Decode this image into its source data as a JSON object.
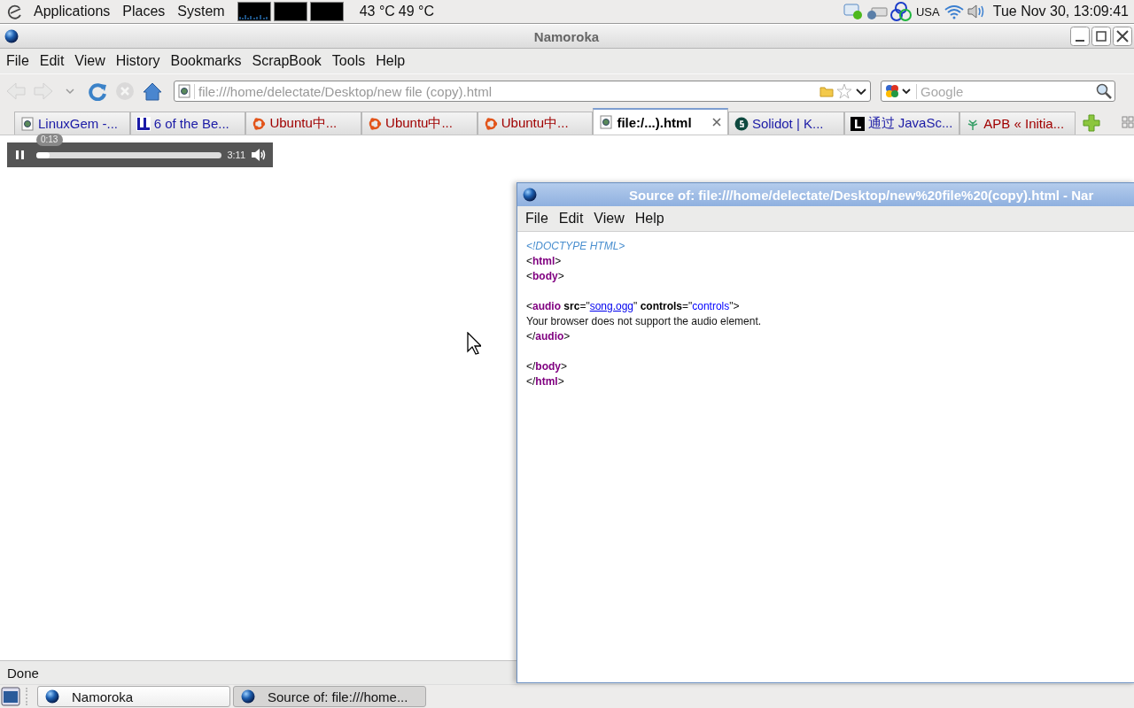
{
  "top_panel": {
    "menus": [
      {
        "label": "Applications"
      },
      {
        "label": "Places"
      },
      {
        "label": "System"
      }
    ],
    "temperatures": [
      "43 °C",
      "49 °C"
    ],
    "keyboard_layout": "USA",
    "clock": "Tue Nov 30, 13:09:41"
  },
  "browser": {
    "title": "Namoroka",
    "menu": [
      {
        "label": "File"
      },
      {
        "label": "Edit"
      },
      {
        "label": "View"
      },
      {
        "label": "History"
      },
      {
        "label": "Bookmarks"
      },
      {
        "label": "ScrapBook"
      },
      {
        "label": "Tools"
      },
      {
        "label": "Help"
      }
    ],
    "nav_buttons": [
      {
        "kind": "back",
        "disabled": true
      },
      {
        "kind": "forward",
        "disabled": true
      },
      {
        "kind": "history",
        "disabled": false
      },
      {
        "kind": "reload",
        "disabled": false
      },
      {
        "kind": "stop",
        "disabled": true
      },
      {
        "kind": "home",
        "disabled": false
      }
    ],
    "url": "file:///home/delectate/Desktop/new file (copy).html",
    "search_placeholder": "Google",
    "tabs": [
      {
        "label": "LinuxGem -...",
        "kind": "page",
        "color": "#1a1aa6",
        "selected": false
      },
      {
        "label": "6 of the Be...",
        "kind": "logo",
        "color": "#1a1aa6",
        "selected": false
      },
      {
        "label": "Ubuntu中...",
        "kind": "ubuntu",
        "color": "#a00000",
        "selected": false
      },
      {
        "label": "Ubuntu中...",
        "kind": "ubuntu",
        "color": "#a00000",
        "selected": false
      },
      {
        "label": "Ubuntu中...",
        "kind": "ubuntu",
        "color": "#a00000",
        "selected": false
      },
      {
        "label": "file:/...).html",
        "kind": "page",
        "color": "#000000",
        "selected": true
      },
      {
        "label": "Solidot | K...",
        "kind": "solidot",
        "color": "#1a1aa6",
        "selected": false
      },
      {
        "label": "通过 JavaSc...",
        "kind": "square",
        "color": "#1a1aa6",
        "selected": false
      },
      {
        "label": "APB « Initia...",
        "kind": "tree",
        "color": "#a00000",
        "selected": false
      }
    ],
    "player": {
      "playing": true,
      "time_bubble": "0:13",
      "level": 0.07,
      "duration": "3:11"
    },
    "status": "Done"
  },
  "source_window": {
    "title": "Source of: file:///home/delectate/Desktop/new%20file%20(copy).html - Nar",
    "menu": [
      {
        "label": "File"
      },
      {
        "label": "Edit"
      },
      {
        "label": "View"
      },
      {
        "label": "Help"
      }
    ],
    "lines": [
      {
        "tokens": [
          {
            "kind": "comment",
            "text": "<!DOCTYPE HTML>"
          }
        ]
      },
      {
        "tokens": [
          {
            "kind": "punct",
            "text": "<"
          },
          {
            "kind": "tag",
            "text": "html"
          },
          {
            "kind": "punct",
            "text": ">"
          }
        ]
      },
      {
        "tokens": [
          {
            "kind": "punct",
            "text": "<"
          },
          {
            "kind": "tag",
            "text": "body"
          },
          {
            "kind": "punct",
            "text": ">"
          }
        ]
      },
      {
        "kind": "blank"
      },
      {
        "tokens": [
          {
            "kind": "punct",
            "text": "<"
          },
          {
            "kind": "tag",
            "text": "audio"
          },
          {
            "kind": "attr",
            "text": " src"
          },
          {
            "kind": "punct",
            "text": "=\""
          },
          {
            "kind": "link",
            "text": "song.ogg"
          },
          {
            "kind": "punct",
            "text": "\" "
          },
          {
            "kind": "attr",
            "text": "controls"
          },
          {
            "kind": "punct",
            "text": "=\""
          },
          {
            "kind": "value",
            "text": "controls"
          },
          {
            "kind": "punct",
            "text": "\">"
          }
        ]
      },
      {
        "tokens": [
          {
            "kind": "text",
            "text": "Your browser does not support the audio element."
          }
        ]
      },
      {
        "tokens": [
          {
            "kind": "punct",
            "text": "</"
          },
          {
            "kind": "tag",
            "text": "audio"
          },
          {
            "kind": "punct",
            "text": ">"
          }
        ]
      },
      {
        "kind": "blank"
      },
      {
        "tokens": [
          {
            "kind": "punct",
            "text": "</"
          },
          {
            "kind": "tag",
            "text": "body"
          },
          {
            "kind": "punct",
            "text": ">"
          }
        ]
      },
      {
        "tokens": [
          {
            "kind": "punct",
            "text": "</"
          },
          {
            "kind": "tag",
            "text": "html"
          },
          {
            "kind": "punct",
            "text": ">"
          }
        ]
      }
    ]
  },
  "taskbar": {
    "tasks": [
      {
        "label": "Namoroka",
        "selected": false
      },
      {
        "label": "Source of: file:///home...",
        "selected": true
      }
    ]
  }
}
